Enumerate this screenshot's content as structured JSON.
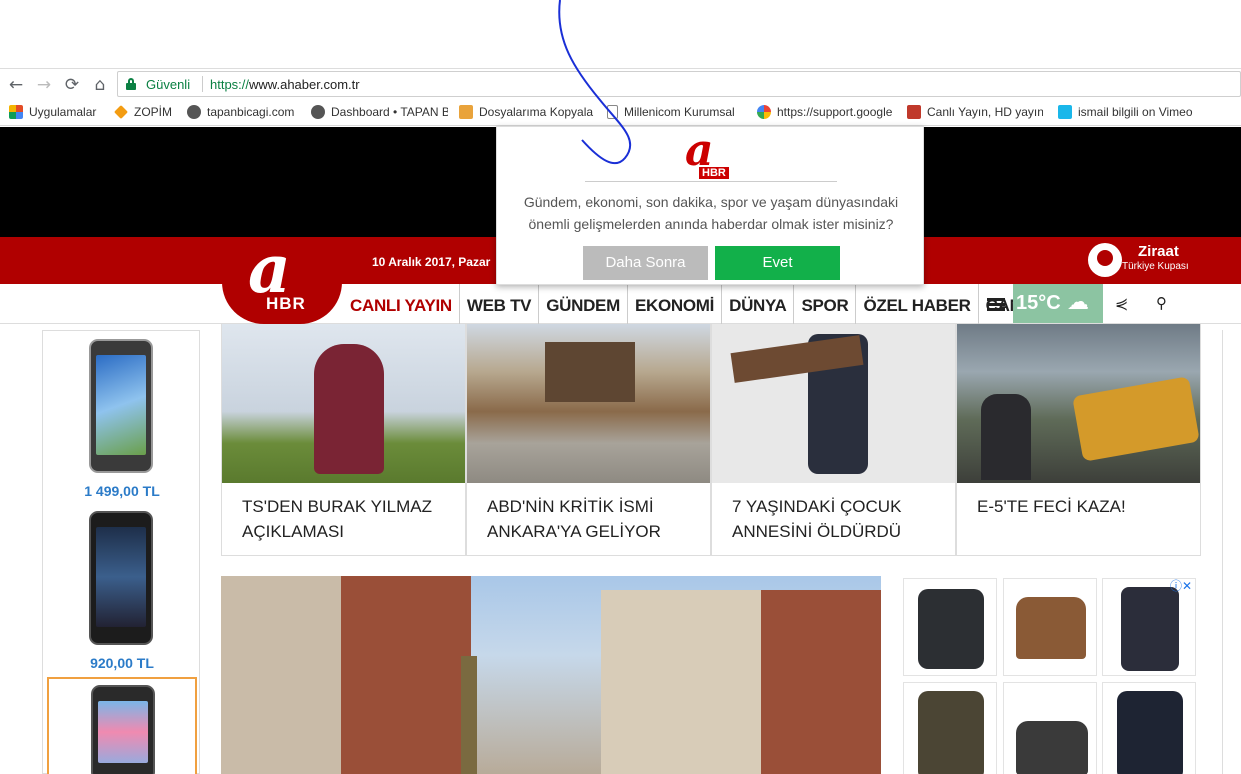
{
  "browser": {
    "secure_label": "Güvenli",
    "url_scheme": "https://",
    "url_host": "www.ahaber.com.tr",
    "bookmarks": [
      {
        "label": "Uygulamalar",
        "icon": "apps-grid-icon",
        "color": "#e34c26"
      },
      {
        "label": "ZOPİM",
        "icon": "zopim-icon",
        "color": "#f39c12"
      },
      {
        "label": "tapanbicagi.com",
        "icon": "site-icon",
        "color": "#555555"
      },
      {
        "label": "Dashboard • TAPAN B",
        "icon": "site-icon",
        "color": "#555555"
      },
      {
        "label": "Dosyalarıma Kopyala",
        "icon": "copy-icon",
        "color": "#e9a33b"
      },
      {
        "label": "Millenicom Kurumsal",
        "icon": "page-icon",
        "color": "#888888"
      },
      {
        "label": "https://support.google",
        "icon": "google-icon",
        "color": "#4285f4"
      },
      {
        "label": "Canlı Yayın, HD yayın,",
        "icon": "tv-icon",
        "color": "#c0392b"
      },
      {
        "label": "ismail bilgili on Vimeo",
        "icon": "vimeo-icon",
        "color": "#1ab7ea"
      }
    ]
  },
  "header": {
    "date": "10 Aralık 2017, Pazar",
    "logo_a": "a",
    "logo_hbr": "HBR",
    "ziraat_title": "Ziraat",
    "ziraat_sub": "Türkiye Kupası"
  },
  "nav": {
    "items": [
      "CANLI YAYIN",
      "WEB TV",
      "GÜNDEM",
      "EKONOMİ",
      "DÜNYA",
      "SPOR",
      "ÖZEL HABER",
      "CANLI"
    ],
    "weather_temp": "15°C",
    "weather_icon": "rain-cloud-icon"
  },
  "left_ad": {
    "prices": [
      "1 499,00 TL",
      "920,00 TL"
    ]
  },
  "cards": [
    {
      "caption": "TS'DEN BURAK YILMAZ AÇIKLAMASI",
      "color": "#6b8c3a"
    },
    {
      "caption": "ABD'NİN KRİTİK İSMİ ANKARA'YA GELİYOR",
      "color": "#8a6a4a"
    },
    {
      "caption": "7 YAŞINDAKİ ÇOCUK ANNESİNİ ÖLDÜRDÜ",
      "color": "#555a66"
    },
    {
      "caption": "E-5'TE FECİ KAZA!",
      "color": "#c98a2a"
    }
  ],
  "modal": {
    "logo_a": "a",
    "logo_hbr": "HBR",
    "message": "Gündem, ekonomi, son dakika, spor ve yaşam dünyasındaki önemli gelişmelerden anında haberdar olmak ister misiniz?",
    "later_label": "Daha Sonra",
    "yes_label": "Evet"
  }
}
